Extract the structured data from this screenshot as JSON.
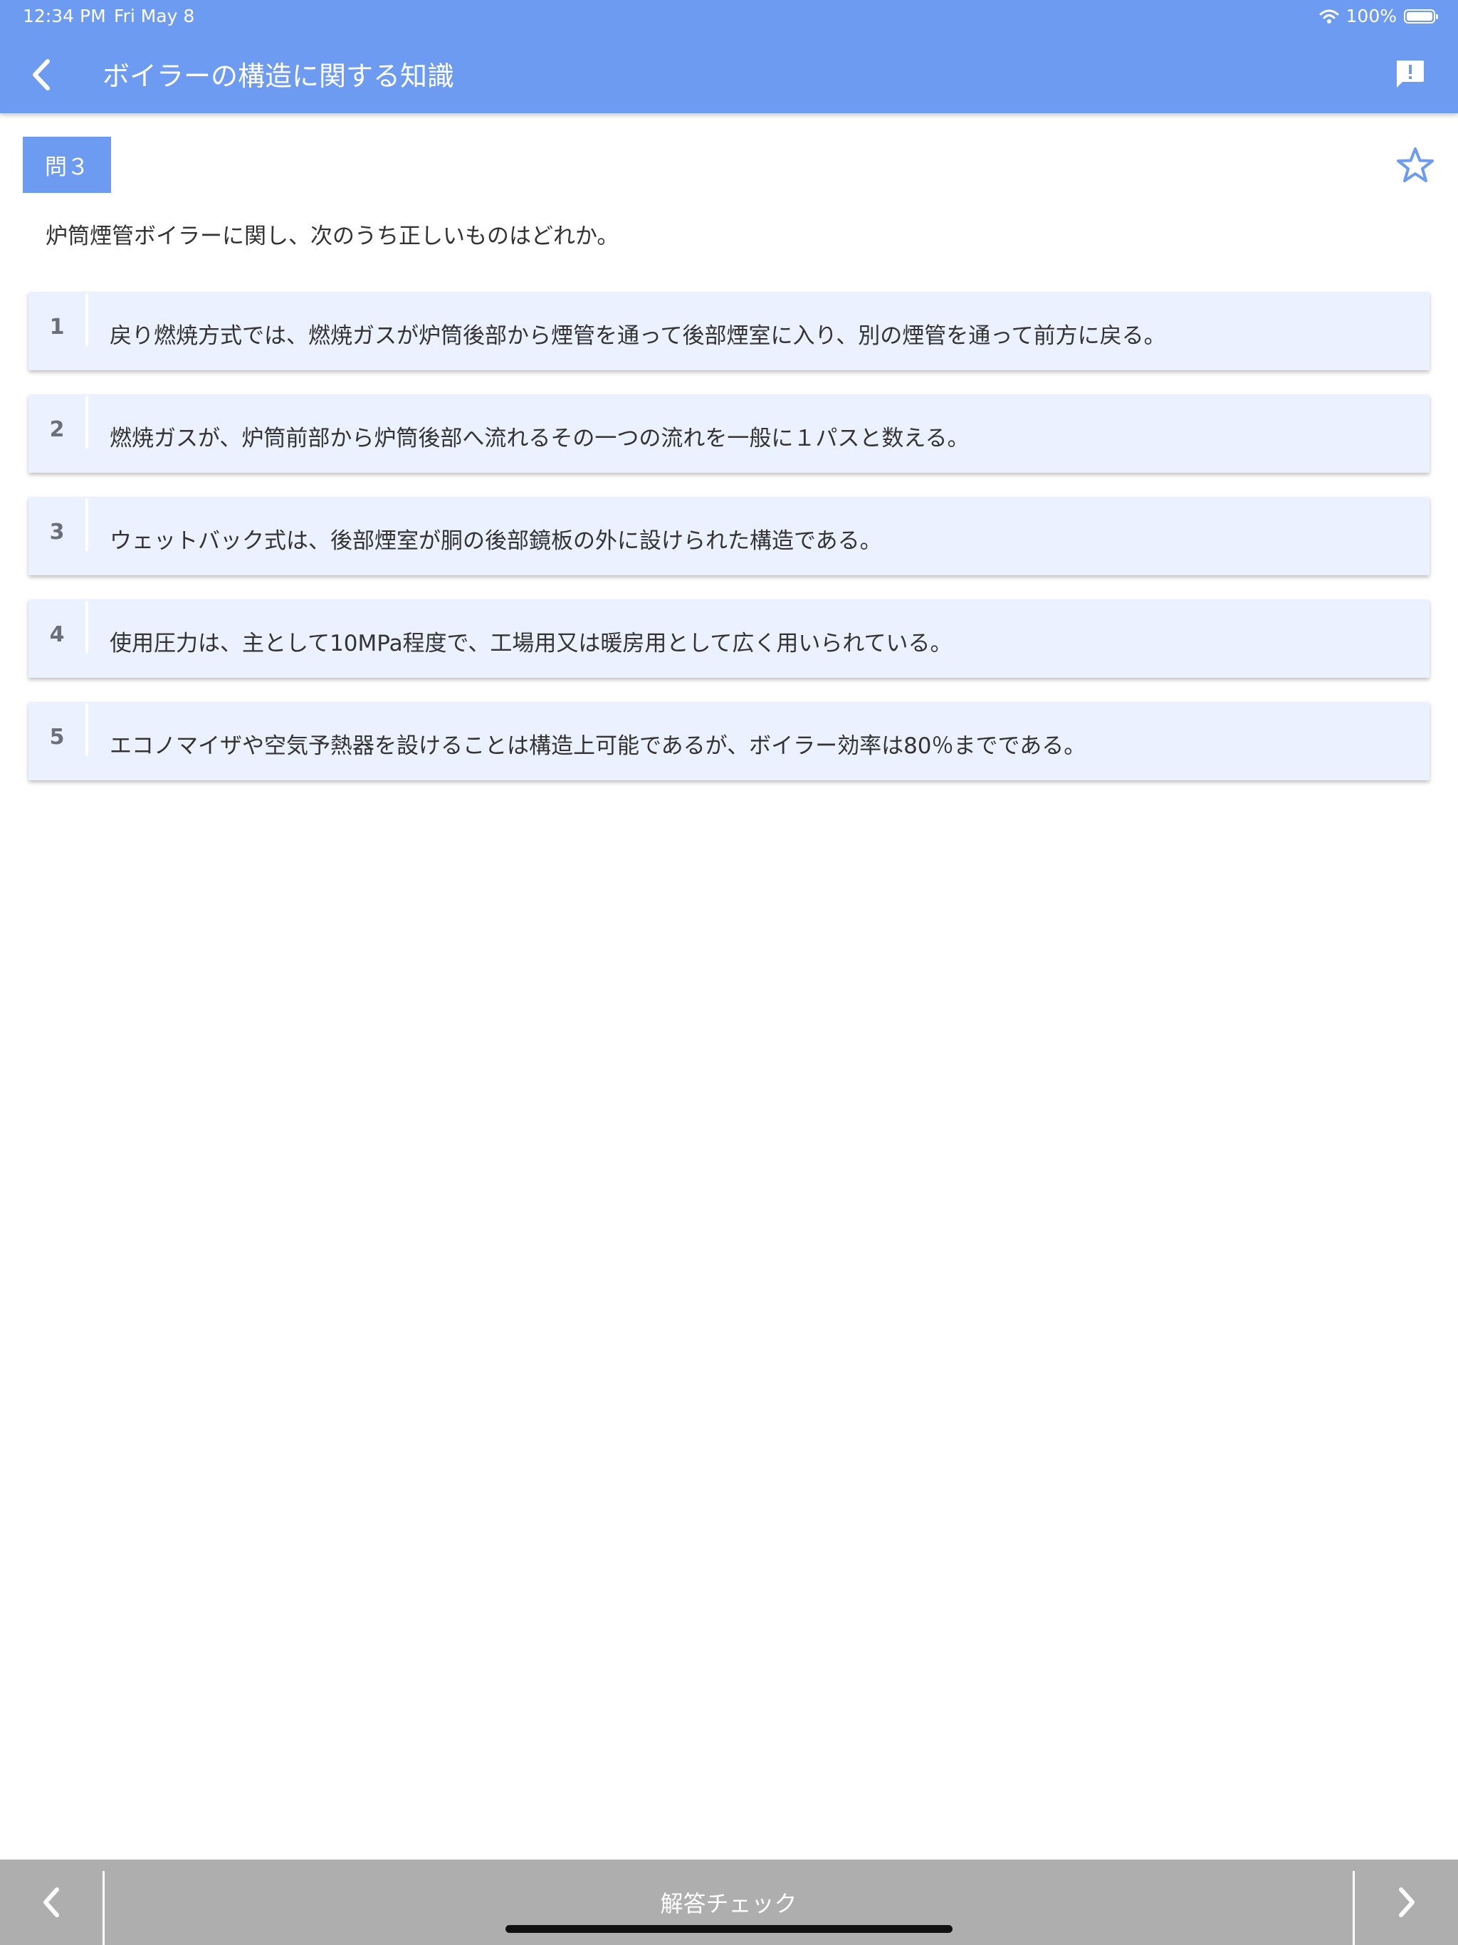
{
  "status_bar": {
    "time": "12:34 PM",
    "date": "Fri May 8",
    "battery": "100%",
    "battery_level": 1.0,
    "icons": [
      "wifi-icon",
      "battery-icon"
    ]
  },
  "header": {
    "title": "ボイラーの構造に関する知識",
    "back_icon": "chevron-left-icon",
    "report_icon": "feedback-icon"
  },
  "question": {
    "badge": "問３",
    "text": "炉筒煙管ボイラーに関し、次のうち正しいものはどれか。",
    "favorite_icon": "star-outline-icon",
    "choices": [
      {
        "number": "1",
        "text": "戻り燃焼方式では、燃焼ガスが炉筒後部から煙管を通って後部煙室に入り、別の煙管を通って前方に戻る。"
      },
      {
        "number": "2",
        "text": "燃焼ガスが、炉筒前部から炉筒後部へ流れるその一つの流れを一般に１パスと数える。"
      },
      {
        "number": "3",
        "text": "ウェットバック式は、後部煙室が胴の後部鏡板の外に設けられた構造である。"
      },
      {
        "number": "4",
        "text": "使用圧力は、主として10MPa程度で、工場用又は暖房用として広く用いられている。"
      },
      {
        "number": "5",
        "text": "エコノマイザや空気予熱器を設けることは構造上可能であるが、ボイラー効率は80％までである。"
      }
    ]
  },
  "bottom_bar": {
    "check_label": "解答チェック",
    "prev_icon": "chevron-left-icon",
    "next_icon": "chevron-right-icon"
  },
  "colors": {
    "primary": "#6d9bf1",
    "choice_background": "#ebf1fe",
    "bottom_bar": "#aeaeaf",
    "text": "#333333"
  }
}
